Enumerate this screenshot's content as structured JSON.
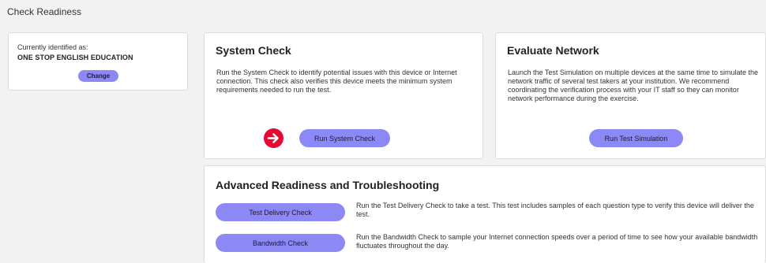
{
  "page": {
    "title": "Check Readiness"
  },
  "identity": {
    "label": "Currently identified as:",
    "value": "ONE STOP ENGLISH EDUCATION",
    "change_label": "Change"
  },
  "system_check": {
    "heading": "System Check",
    "description": "Run the System Check to identify potential issues with this device or Internet connection. This check also verifies this device meets the minimum system requirements needed to run the test.",
    "button_label": "Run System Check",
    "indicator_icon": "arrow-right-circle-icon"
  },
  "evaluate_network": {
    "heading": "Evaluate Network",
    "description": "Launch the Test Simulation on multiple devices at the same time to simulate the network traffic of several test takers at your institution. We recommend coordinating the verification process with your IT staff so they can monitor network performance during the exercise.",
    "button_label": "Run Test Simulation"
  },
  "advanced": {
    "heading": "Advanced Readiness and Troubleshooting",
    "items": [
      {
        "button_label": "Test Delivery Check",
        "description": "Run the Test Delivery Check to take a test. This test includes samples of each question type to verify this device will deliver the test."
      },
      {
        "button_label": "Bandwidth Check",
        "description": "Run the Bandwidth Check to sample your Internet connection speeds over a period of time to see how your available bandwidth fluctuates throughout the day."
      }
    ]
  },
  "colors": {
    "button": "#8c88f5",
    "indicator": "#e5092f",
    "background": "#f2f2f2"
  }
}
